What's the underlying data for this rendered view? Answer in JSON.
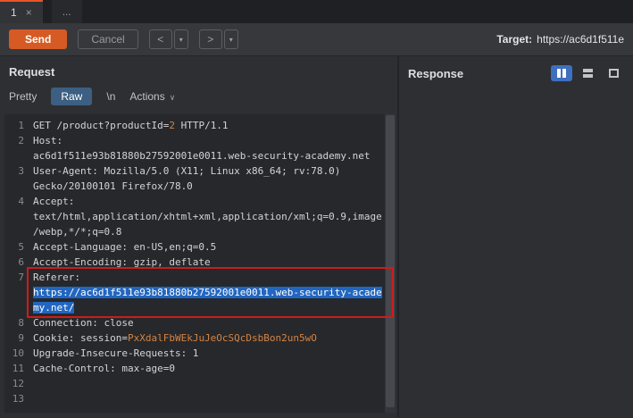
{
  "topbar": {
    "tabs": [
      {
        "label": "1",
        "close": "×"
      },
      {
        "label": "..."
      }
    ]
  },
  "toolbar": {
    "send_label": "Send",
    "cancel_label": "Cancel",
    "back_label": "<",
    "forward_label": ">",
    "dropdown_glyph": "▾",
    "target_label": "Target:",
    "target_value": "https://ac6d1f511e"
  },
  "request_panel": {
    "title": "Request",
    "tabs": {
      "pretty": "Pretty",
      "raw": "Raw",
      "newline": "\\n",
      "actions": "Actions",
      "actions_chevron": "∨"
    },
    "selected_tab": "Raw"
  },
  "response_panel": {
    "title": "Response"
  },
  "colors": {
    "accent_orange": "#d65a23",
    "selection_blue": "#2166c0",
    "annotation_red": "#cf1b1b",
    "value_orange": "#d28445",
    "raw_tab_blue": "#3c5f82"
  },
  "request_editor": {
    "rows": [
      {
        "n": "1",
        "parts": [
          {
            "t": "GET /product?productId="
          },
          {
            "t": "2",
            "c": "val"
          },
          {
            "t": " HTTP/1.1"
          }
        ]
      },
      {
        "n": "2",
        "parts": [
          {
            "t": "Host:"
          }
        ]
      },
      {
        "n": "",
        "parts": [
          {
            "t": "ac6d1f511e93b81880b27592001e0011.web-security-academy.net"
          }
        ]
      },
      {
        "n": "3",
        "parts": [
          {
            "t": "User-Agent: Mozilla/5.0 (X11; Linux x86_64; rv:78.0)"
          }
        ]
      },
      {
        "n": "",
        "parts": [
          {
            "t": "Gecko/20100101 Firefox/78.0"
          }
        ]
      },
      {
        "n": "4",
        "parts": [
          {
            "t": "Accept:"
          }
        ]
      },
      {
        "n": "",
        "parts": [
          {
            "t": "text/html,application/xhtml+xml,application/xml;q=0.9,image"
          }
        ]
      },
      {
        "n": "",
        "parts": [
          {
            "t": "/webp,*/*;q=0.8"
          }
        ]
      },
      {
        "n": "5",
        "parts": [
          {
            "t": "Accept-Language: en-US,en;q=0.5"
          }
        ]
      },
      {
        "n": "6",
        "parts": [
          {
            "t": "Accept-Encoding: gzip, deflate"
          }
        ]
      },
      {
        "n": "7",
        "boxed": true,
        "parts": [
          {
            "t": "Referer:"
          }
        ]
      },
      {
        "n": "",
        "boxed": true,
        "parts": [
          {
            "t": "https://ac6d1f511e93b81880b27592001e0011.web-security-acade",
            "c": "sel"
          }
        ]
      },
      {
        "n": "",
        "boxed": true,
        "parts": [
          {
            "t": "my.net/",
            "c": "sel"
          }
        ]
      },
      {
        "n": "8",
        "parts": [
          {
            "t": "Connection: close"
          }
        ]
      },
      {
        "n": "9",
        "parts": [
          {
            "t": "Cookie: session="
          },
          {
            "t": "PxXdalFbWEkJuJeOcSQcDsbBon2un5wO",
            "c": "val"
          }
        ]
      },
      {
        "n": "10",
        "parts": [
          {
            "t": "Upgrade-Insecure-Requests: 1"
          }
        ]
      },
      {
        "n": "11",
        "parts": [
          {
            "t": "Cache-Control: max-age=0"
          }
        ]
      },
      {
        "n": "12",
        "parts": []
      },
      {
        "n": "13",
        "parts": []
      }
    ]
  }
}
